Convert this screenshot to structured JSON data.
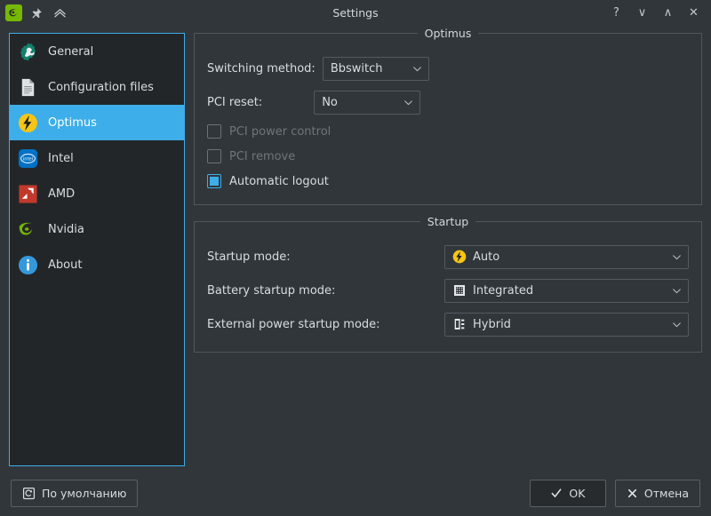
{
  "window": {
    "title": "Settings",
    "left_icons": [
      {
        "name": "app-icon",
        "label": "nvidia-app-icon"
      },
      {
        "name": "pin-icon",
        "label": "pin"
      },
      {
        "name": "shade-icon",
        "label": "collapse"
      }
    ],
    "controls": [
      {
        "name": "help-button",
        "glyph": "?"
      },
      {
        "name": "minimize-button",
        "glyph": "∨"
      },
      {
        "name": "maximize-button",
        "glyph": "∧"
      },
      {
        "name": "close-button",
        "glyph": "✕"
      }
    ]
  },
  "sidebar": {
    "items": [
      {
        "label": "General",
        "icon": "gear-wrench-icon",
        "selected": false
      },
      {
        "label": "Configuration files",
        "icon": "document-icon",
        "selected": false
      },
      {
        "label": "Optimus",
        "icon": "lightning-bolt-icon",
        "selected": true
      },
      {
        "label": "Intel",
        "icon": "intel-logo-icon",
        "selected": false
      },
      {
        "label": "AMD",
        "icon": "amd-logo-icon",
        "selected": false
      },
      {
        "label": "Nvidia",
        "icon": "nvidia-logo-icon",
        "selected": false
      },
      {
        "label": "About",
        "icon": "info-icon",
        "selected": false
      }
    ]
  },
  "optimus": {
    "title": "Optimus",
    "switching_method": {
      "label": "Switching method:",
      "value": "Bbswitch"
    },
    "pci_reset": {
      "label": "PCI reset:",
      "value": "No"
    },
    "checkboxes": [
      {
        "label": "PCI power control",
        "checked": false,
        "disabled": true
      },
      {
        "label": "PCI remove",
        "checked": false,
        "disabled": true
      },
      {
        "label": "Automatic logout",
        "checked": true,
        "disabled": false
      }
    ]
  },
  "startup": {
    "title": "Startup",
    "rows": [
      {
        "label": "Startup mode:",
        "value": "Auto",
        "icon": "lightning-bolt-icon"
      },
      {
        "label": "Battery startup mode:",
        "value": "Integrated",
        "icon": "integrated-chip-icon"
      },
      {
        "label": "External power startup mode:",
        "value": "Hybrid",
        "icon": "hybrid-chip-icon"
      }
    ]
  },
  "footer": {
    "defaults_label": "По умолчанию",
    "ok_label": "OK",
    "cancel_label": "Отмена"
  },
  "colors": {
    "accent": "#3daee9",
    "window_bg": "#31363b",
    "list_bg": "#232629",
    "text": "#d8dde1",
    "disabled_text": "#6f757a",
    "border": "#50565b"
  }
}
